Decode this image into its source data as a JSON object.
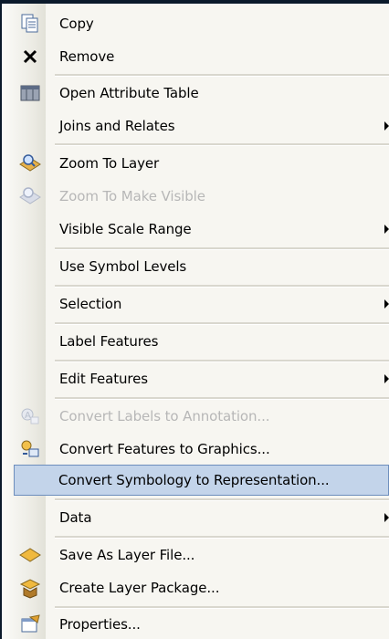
{
  "items": [
    {
      "label": "Copy",
      "icon": "copy-icon"
    },
    {
      "label": "Remove",
      "icon": "remove-icon"
    },
    {
      "label": "Open Attribute Table",
      "icon": "table-icon"
    },
    {
      "label": "Joins and Relates",
      "submenu": true
    },
    {
      "label": "Zoom To Layer",
      "icon": "zoom-layer-icon"
    },
    {
      "label": "Zoom To Make Visible",
      "icon": "zoom-visible-icon",
      "disabled": true
    },
    {
      "label": "Visible Scale Range",
      "submenu": true
    },
    {
      "label": "Use Symbol Levels"
    },
    {
      "label": "Selection",
      "submenu": true
    },
    {
      "label": "Label Features"
    },
    {
      "label": "Edit Features",
      "submenu": true
    },
    {
      "label": "Convert Labels to Annotation...",
      "icon": "labels-annotation-icon",
      "disabled": true
    },
    {
      "label": "Convert Features to Graphics...",
      "icon": "features-graphics-icon"
    },
    {
      "label": "Convert Symbology to Representation...",
      "highlighted": true
    },
    {
      "label": "Data",
      "submenu": true
    },
    {
      "label": "Save As Layer File...",
      "icon": "layer-file-icon"
    },
    {
      "label": "Create Layer Package...",
      "icon": "layer-package-icon"
    },
    {
      "label": "Properties...",
      "icon": "properties-icon"
    }
  ],
  "colors": {
    "highlight": "#c3d4ea",
    "disabled_text": "#b7b7b7"
  }
}
